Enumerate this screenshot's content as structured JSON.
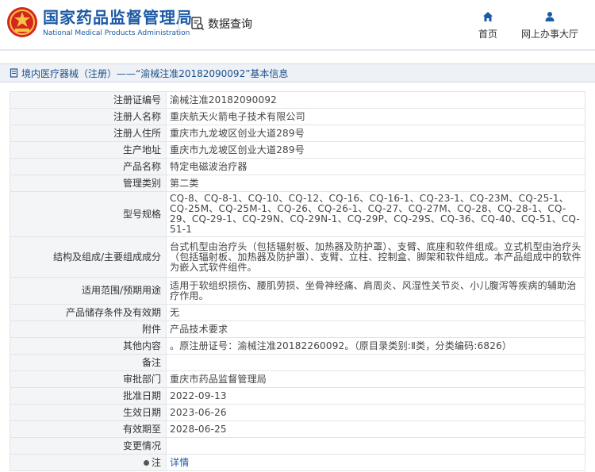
{
  "header": {
    "brand_cn": "国家药品监督管理局",
    "brand_en": "National Medical Products Administration",
    "db_query_label": "数据查询",
    "nav": [
      {
        "label": "首页",
        "icon": "home-icon"
      },
      {
        "label": "网上办事大厅",
        "icon": "user-icon"
      }
    ],
    "brand_color": "#1b5aa6",
    "logo_color": "#d7261e"
  },
  "breadcrumb": {
    "text": "境内医疗器械（注册）——“渝械注准20182090092”基本信息"
  },
  "details": [
    {
      "key": "注册证编号",
      "value": "渝械注准20182090092"
    },
    {
      "key": "注册人名称",
      "value": "重庆航天火箭电子技术有限公司"
    },
    {
      "key": "注册人住所",
      "value": "重庆市九龙坡区创业大道289号"
    },
    {
      "key": "生产地址",
      "value": "重庆市九龙坡区创业大道289号"
    },
    {
      "key": "产品名称",
      "value": "特定电磁波治疗器"
    },
    {
      "key": "管理类别",
      "value": "第二类"
    },
    {
      "key": "型号规格",
      "value": "CQ-8、CQ-8-1、CQ-10、CQ-12、CQ-16、CQ-16-1、CQ-23-1、CQ-23M、CQ-25-1、CQ-25M、CQ-25M-1、CQ-26、CQ-26-1、CQ-27、CQ-27M、CQ-28、CQ-28-1、CQ-29、CQ-29-1、CQ-29N、CQ-29N-1、CQ-29P、CQ-29S、CQ-36、CQ-40、CQ-51、CQ-51-1"
    },
    {
      "key": "结构及组成/主要组成成分",
      "value": "台式机型由治疗头（包括辐射板、加热器及防护罩）、支臂、底座和软件组成。立式机型由治疗头（包括辐射板、加热器及防护罩）、支臂、立柱、控制盒、脚架和软件组成。本产品组成中的软件为嵌入式软件组件。"
    },
    {
      "key": "适用范围/预期用途",
      "value": "适用于软组织损伤、腰肌劳损、坐骨神经痛、肩周炎、风湿性关节炎、小儿腹泻等疾病的辅助治疗作用。"
    },
    {
      "key": "产品储存条件及有效期",
      "value": "无"
    },
    {
      "key": "附件",
      "value": "产品技术要求"
    },
    {
      "key": "其他内容",
      "value": "。原注册证号：渝械注准20182260092。（原目录类别:Ⅱ类，分类编码:6826）"
    },
    {
      "key": "备注",
      "value": ""
    },
    {
      "key": "审批部门",
      "value": "重庆市药品监督管理局"
    },
    {
      "key": "批准日期",
      "value": "2022-09-13"
    },
    {
      "key": "生效日期",
      "value": "2023-06-26"
    },
    {
      "key": "有效期至",
      "value": "2028-06-25"
    },
    {
      "key": "变更情况",
      "value": ""
    }
  ],
  "note_row": {
    "key": "注",
    "link": "详情"
  }
}
